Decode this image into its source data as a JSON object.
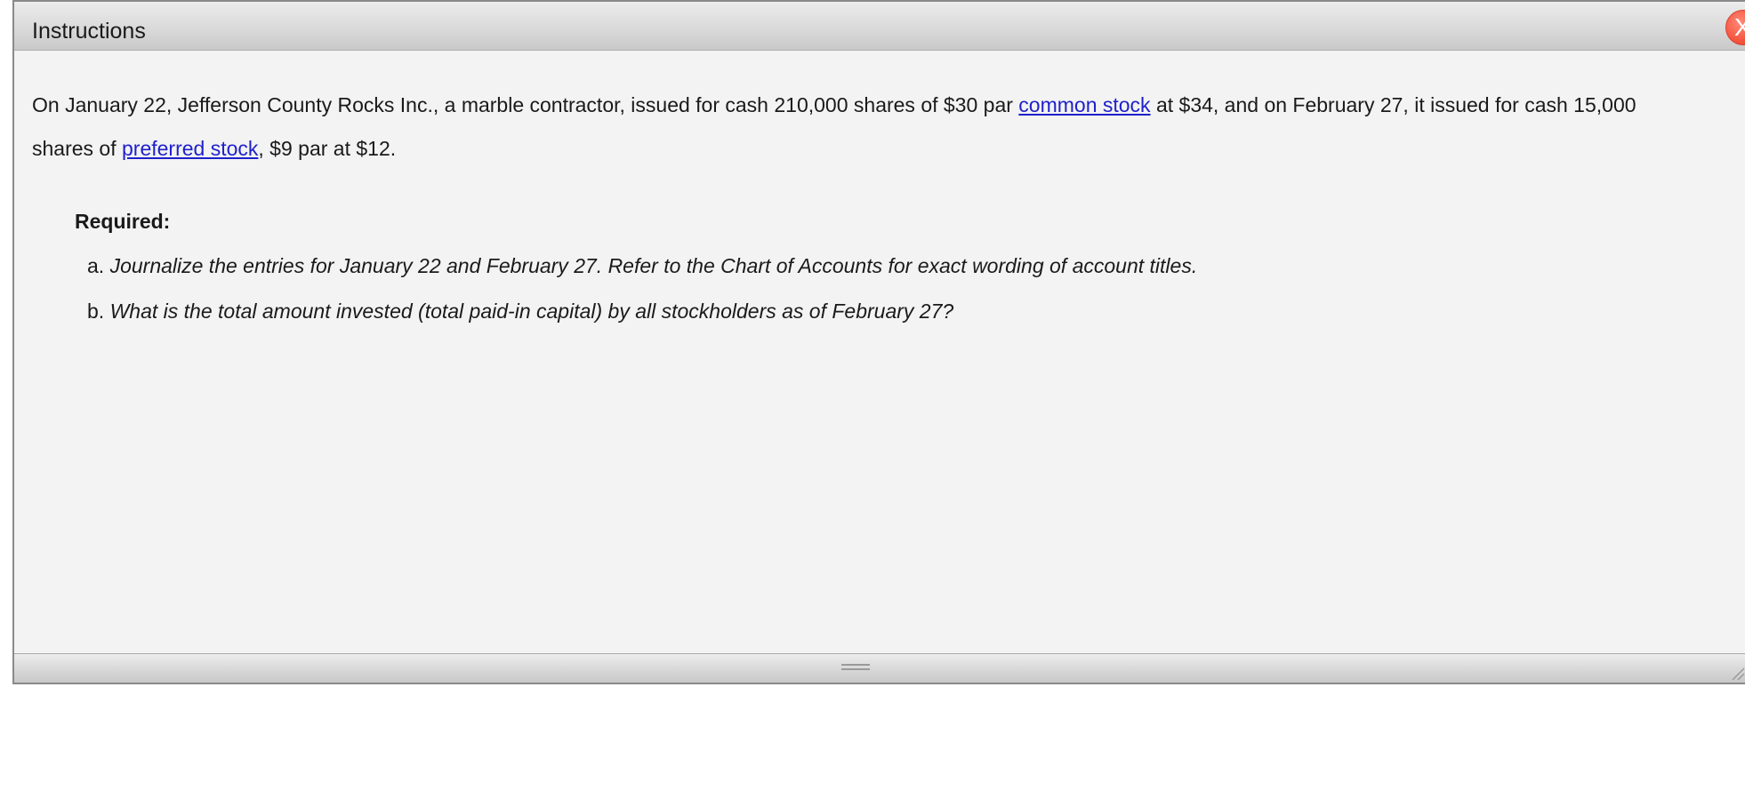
{
  "dialog": {
    "title": "Instructions",
    "close_label": "X"
  },
  "intro": {
    "part1": "On January 22, Jefferson County Rocks Inc., a marble contractor, issued for cash 210,000 shares of $30 par ",
    "link1": "common stock",
    "part2": " at $34, and on February 27, it issued for cash 15,000",
    "part3": "shares of ",
    "link2": "preferred stock",
    "part4": ", $9 par at $12."
  },
  "required": {
    "heading": "Required:",
    "items": [
      {
        "marker": "a.",
        "text": "Journalize the entries for January 22 and February 27. Refer to the Chart of Accounts for exact wording of account titles."
      },
      {
        "marker": "b.",
        "text": "What is the total amount invested (total paid-in capital) by all stockholders as of February 27?"
      }
    ]
  },
  "colors": {
    "link": "#1f1fcc",
    "close_button": "#f4553f",
    "background": "#f2f3f2"
  },
  "icons": {
    "close": "close-icon",
    "resize_grip": "resize-grip-icon",
    "resize_corner": "resize-corner-icon"
  }
}
